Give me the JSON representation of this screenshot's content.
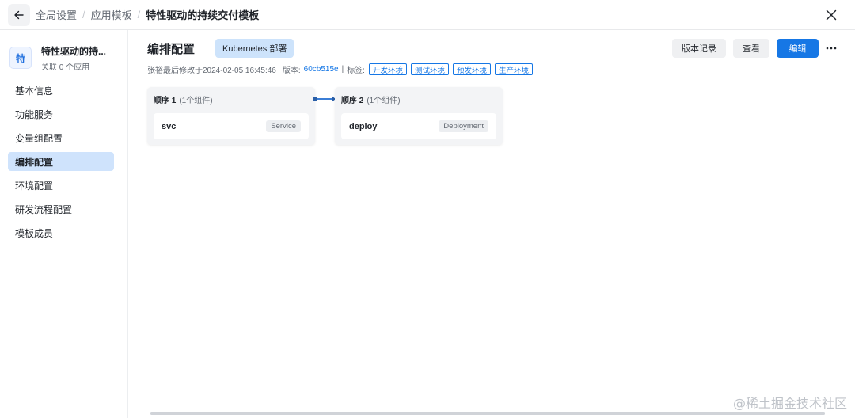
{
  "header": {
    "breadcrumbs": [
      "全局设置",
      "应用模板"
    ],
    "separator": "/",
    "current": "特性驱动的持续交付模板"
  },
  "sidebar": {
    "template": {
      "avatar_char": "特",
      "name": "特性驱动的持...",
      "linked_prefix": "关联",
      "linked_count": "0",
      "linked_suffix": "个应用"
    },
    "items": [
      {
        "label": "基本信息",
        "active": false
      },
      {
        "label": "功能服务",
        "active": false
      },
      {
        "label": "变量组配置",
        "active": false
      },
      {
        "label": "编排配置",
        "active": true
      },
      {
        "label": "环境配置",
        "active": false
      },
      {
        "label": "研发流程配置",
        "active": false
      },
      {
        "label": "模板成员",
        "active": false
      }
    ]
  },
  "main": {
    "title": "编排配置",
    "type_tag": "Kubernetes 部署",
    "actions": {
      "history": "版本记录",
      "view": "查看",
      "edit": "编辑"
    },
    "meta": {
      "modified": "张裕最后修改于2024-02-05 16:45:46",
      "version_label": "版本:",
      "version_hash": "60cb515e",
      "bar": "|",
      "tags_label": "标签:",
      "tags": [
        "开发环境",
        "测试环境",
        "预发环境",
        "生产环境"
      ]
    },
    "stages": [
      {
        "label": "顺序 1",
        "count": "(1个组件)",
        "component": {
          "name": "svc",
          "kind": "Service"
        }
      },
      {
        "label": "顺序 2",
        "count": "(1个组件)",
        "component": {
          "name": "deploy",
          "kind": "Deployment"
        }
      }
    ]
  },
  "watermark": "@稀土掘金技术社区",
  "colors": {
    "primary": "#1677e5",
    "active_nav": "#cfe3fc",
    "stage_bg": "#f3f4f6"
  }
}
